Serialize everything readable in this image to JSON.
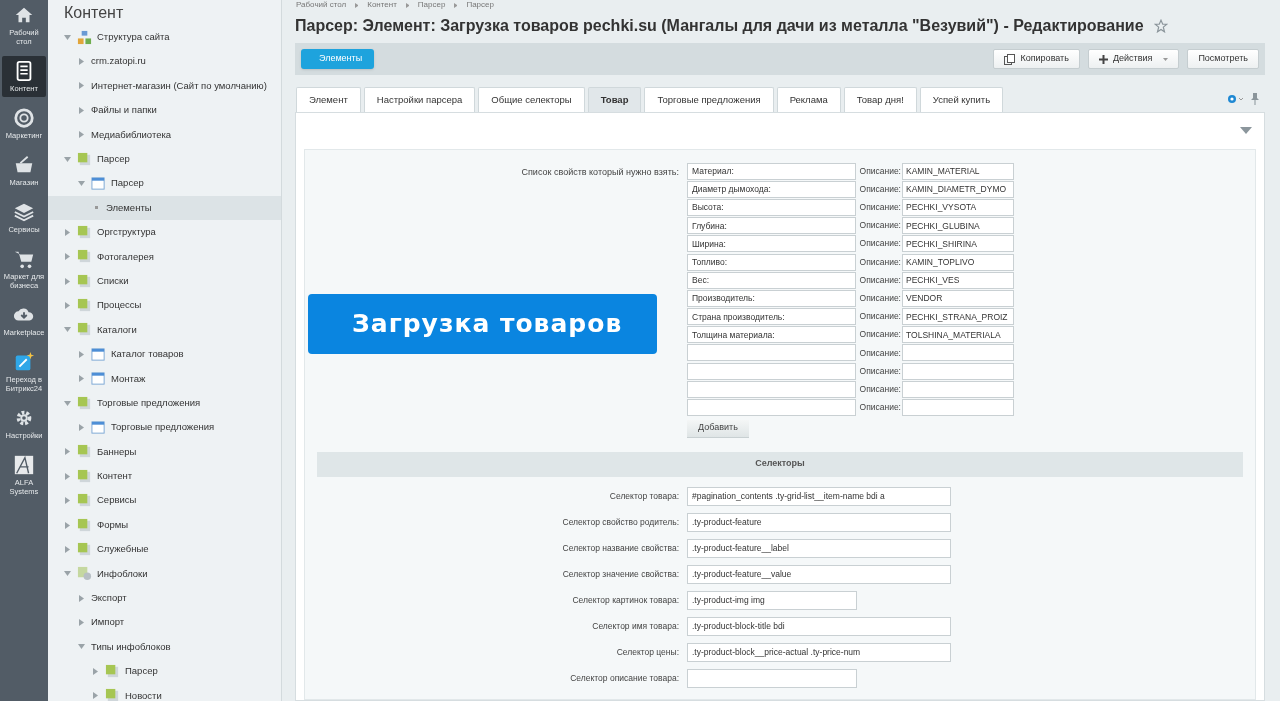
{
  "rail": [
    {
      "label": "Рабочий стол",
      "kind": "home",
      "selected": false
    },
    {
      "label": "Контент",
      "kind": "doc",
      "selected": true
    },
    {
      "label": "Маркетинг",
      "kind": "target",
      "selected": false
    },
    {
      "label": "Магазин",
      "kind": "basket",
      "selected": false
    },
    {
      "label": "Сервисы",
      "kind": "layers",
      "selected": false
    },
    {
      "label": "Маркет для бизнеса",
      "kind": "cart",
      "selected": false
    },
    {
      "label": "Marketplace",
      "kind": "cloud",
      "selected": false
    },
    {
      "label": "Переход в Битрикс24",
      "kind": "wand",
      "selected": false
    },
    {
      "label": "Настройки",
      "kind": "gear",
      "selected": false
    },
    {
      "label": "ALFA Systems",
      "kind": "alfa",
      "selected": false
    }
  ],
  "tree": {
    "title": "Контент",
    "items": [
      {
        "label": "Структура сайта",
        "kind": "site",
        "expanded": true,
        "selected": false,
        "children": [
          {
            "label": "crm.zatopi.ru",
            "kind": "plain",
            "expanded": false,
            "selected": false
          },
          {
            "label": "Интернет-магазин (Сайт по умолчанию)",
            "kind": "plain",
            "expanded": false,
            "selected": false
          },
          {
            "label": "Файлы и папки",
            "kind": "plain",
            "expanded": false,
            "selected": false
          },
          {
            "label": "Медиабиблиотека",
            "kind": "plain",
            "expanded": false,
            "selected": false
          }
        ]
      },
      {
        "label": "Парсер",
        "kind": "block",
        "expanded": true,
        "selected": false,
        "children": [
          {
            "label": "Парсер",
            "kind": "calendar",
            "expanded": true,
            "selected": false,
            "children": [
              {
                "label": "Элементы",
                "kind": "leaf",
                "selected": true
              }
            ]
          }
        ]
      },
      {
        "label": "Оргструктура",
        "kind": "block",
        "expanded": false,
        "selected": false
      },
      {
        "label": "Фотогалерея",
        "kind": "block",
        "expanded": false,
        "selected": false
      },
      {
        "label": "Списки",
        "kind": "block",
        "expanded": false,
        "selected": false
      },
      {
        "label": "Процессы",
        "kind": "block",
        "expanded": false,
        "selected": false
      },
      {
        "label": "Каталоги",
        "kind": "block",
        "expanded": true,
        "selected": false,
        "children": [
          {
            "label": "Каталог товаров",
            "kind": "calendar",
            "expanded": false,
            "selected": false
          },
          {
            "label": "Монтаж",
            "kind": "calendar",
            "expanded": false,
            "selected": false
          }
        ]
      },
      {
        "label": "Торговые предложения",
        "kind": "block",
        "expanded": true,
        "selected": false,
        "children": [
          {
            "label": "Торговые предложения",
            "kind": "calendar",
            "expanded": false,
            "selected": false
          }
        ]
      },
      {
        "label": "Баннеры",
        "kind": "block",
        "expanded": false,
        "selected": false
      },
      {
        "label": "Контент",
        "kind": "block",
        "expanded": false,
        "selected": false
      },
      {
        "label": "Сервисы",
        "kind": "block",
        "expanded": false,
        "selected": false
      },
      {
        "label": "Формы",
        "kind": "block",
        "expanded": false,
        "selected": false
      },
      {
        "label": "Служебные",
        "kind": "block",
        "expanded": false,
        "selected": false
      },
      {
        "label": "Инфоблоки",
        "kind": "infoblock",
        "expanded": true,
        "selected": false,
        "children": [
          {
            "label": "Экспорт",
            "kind": "plain",
            "expanded": false,
            "selected": false
          },
          {
            "label": "Импорт",
            "kind": "plain",
            "expanded": false,
            "selected": false
          },
          {
            "label": "Типы инфоблоков",
            "kind": "plain",
            "expanded": true,
            "selected": false,
            "children": [
              {
                "label": "Парсер",
                "kind": "block",
                "expanded": false,
                "selected": false
              },
              {
                "label": "Новости",
                "kind": "block",
                "expanded": false,
                "selected": false
              }
            ]
          }
        ]
      }
    ]
  },
  "breadcrumbs": [
    "Рабочий стол",
    "Контент",
    "Парсер",
    "Парсер"
  ],
  "page_title": "Парсер: Элемент: Загрузка товаров pechki.su (Мангалы для дачи из металла \"Везувий\") - Редактирование",
  "toolbar": {
    "back_button": "Элементы",
    "buttons": [
      {
        "label": "Копировать",
        "kind": "copy"
      },
      {
        "label": "Действия",
        "kind": "plus"
      },
      {
        "label": "Посмотреть",
        "kind": "plain"
      }
    ]
  },
  "tabs": [
    {
      "label": "Элемент",
      "selected": false
    },
    {
      "label": "Настройки парсера",
      "selected": false
    },
    {
      "label": "Общие селекторы",
      "selected": false
    },
    {
      "label": "Товар",
      "selected": true
    },
    {
      "label": "Торговые предложения",
      "selected": false
    },
    {
      "label": "Реклама",
      "selected": false
    },
    {
      "label": "Товар дня!",
      "selected": false
    },
    {
      "label": "Успей купить",
      "selected": false
    }
  ],
  "properties": {
    "label": "Список свойств который нужно взять:",
    "rows": [
      {
        "name": "Материал:",
        "description_label": "Описание:",
        "description": "KAMIN_MATERIAL"
      },
      {
        "name": "Диаметр дымохода:",
        "description_label": "Описание:",
        "description": "KAMIN_DIAMETR_DYMO"
      },
      {
        "name": "Высота:",
        "description_label": "Описание:",
        "description": "PECHKI_VYSOTA"
      },
      {
        "name": "Глубина:",
        "description_label": "Описание:",
        "description": "PECHKI_GLUBINA"
      },
      {
        "name": "Ширина:",
        "description_label": "Описание:",
        "description": "PECHKI_SHIRINA"
      },
      {
        "name": "Топливо:",
        "description_label": "Описание:",
        "description": "KAMIN_TOPLIVO"
      },
      {
        "name": "Вес:",
        "description_label": "Описание:",
        "description": "PECHKI_VES"
      },
      {
        "name": "Производитель:",
        "description_label": "Описание:",
        "description": "VENDOR"
      },
      {
        "name": "Страна производитель:",
        "description_label": "Описание:",
        "description": "PECHKI_STRANA_PROIZ"
      },
      {
        "name": "Толщина материала:",
        "description_label": "Описание:",
        "description": "TOLSHINA_MATERIALA"
      },
      {
        "description_label": "Описание:"
      },
      {
        "description_label": "Описание:"
      },
      {
        "description_label": "Описание:"
      },
      {
        "description_label": "Описание:"
      }
    ],
    "add_button": "Добавить"
  },
  "selectors": {
    "heading": "Селекторы",
    "rows": [
      {
        "label": "Селектор товара:",
        "value": "#pagination_contents .ty-grid-list__item-name bdi a",
        "kind": "long"
      },
      {
        "label": "Селектор свойство родитель:",
        "value": ".ty-product-feature",
        "kind": "long"
      },
      {
        "label": "Селектор название свойства:",
        "value": ".ty-product-feature__label",
        "kind": "long"
      },
      {
        "label": "Селектор значение свойства:",
        "value": ".ty-product-feature__value",
        "kind": "long"
      },
      {
        "label": "Селектор картинок товара:",
        "value": ".ty-product-img img",
        "kind": "short"
      },
      {
        "label": "Селектор имя товара:",
        "value": ".ty-product-block-title bdi",
        "kind": "long"
      },
      {
        "label": "Селектор цены:",
        "value": ".ty-product-block__price-actual .ty-price-num",
        "kind": "long"
      },
      {
        "label": "Селектор описание товара:",
        "kind": "short"
      }
    ]
  },
  "overlay_caption": "Загрузка товаров"
}
